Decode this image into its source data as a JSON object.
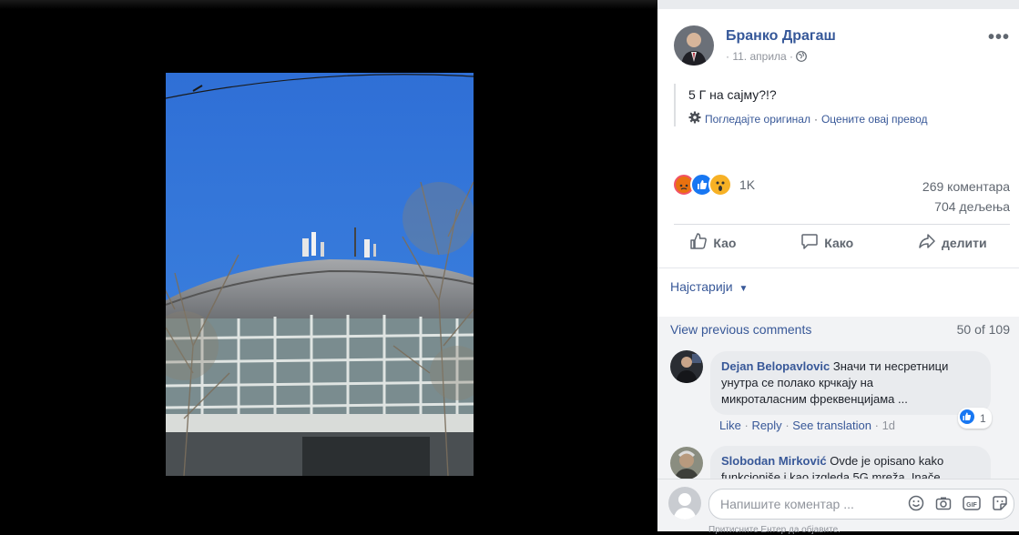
{
  "post": {
    "author": "Бранко Драгаш",
    "date": "11. априла",
    "text": "5 Г на сајму?!?",
    "translation_view_original": "Погледајте оригинал",
    "translation_rate": "Оцените овај превод",
    "reactions_count": "1K",
    "comments_count": "269 коментара",
    "shares_count": "704 дељења"
  },
  "actions": {
    "like": "Као",
    "comment": "Како",
    "share": "делити"
  },
  "sort_label": "Најстарији",
  "comments": {
    "view_previous": "View previous comments",
    "pager": "50 of 109",
    "items": [
      {
        "author": "Dejan Belopavlovic",
        "text_line1": "Значи ти несретници",
        "text_line2": "унутра се полако крчкају на",
        "text_line3": "микроталасним фреквенцијама ...",
        "like": "Like",
        "reply": "Reply",
        "translation": "See translation",
        "time": "1d",
        "likes": "1"
      },
      {
        "author": "Slobodan Mirković",
        "text_line1": "Ovde je opisano kako",
        "text_line2": "funkcioniše i kao izgleda 5G mreža. Inače"
      }
    ]
  },
  "composer": {
    "placeholder": "Напишите коментар ...",
    "hint": "Притисните Ентер да објавите."
  },
  "colors": {
    "link": "#385898",
    "panel_bg": "#ffffff",
    "comments_bg": "#f2f3f5",
    "like_blue": "#1877f2"
  }
}
